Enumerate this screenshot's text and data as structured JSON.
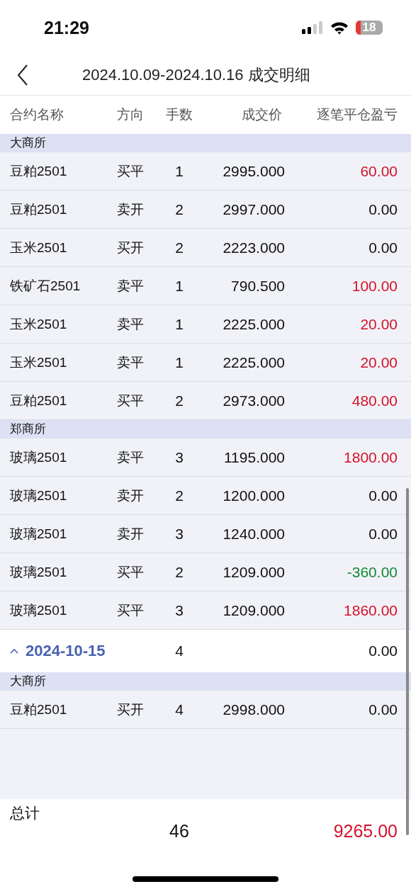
{
  "status_bar": {
    "time": "21:29",
    "battery": "18"
  },
  "nav": {
    "title": "2024.10.09-2024.10.16 成交明细"
  },
  "columns": [
    "合约名称",
    "方向",
    "手数",
    "成交价",
    "逐笔平仓盈亏"
  ],
  "items": [
    {
      "kind": "section",
      "label": "大商所"
    },
    {
      "kind": "trade",
      "name": "豆粕2501",
      "side": "买平",
      "qty": "1",
      "price": "2995.000",
      "pnl": "60.00",
      "color": "#d4122a"
    },
    {
      "kind": "trade",
      "name": "豆粕2501",
      "side": "卖开",
      "qty": "2",
      "price": "2997.000",
      "pnl": "0.00",
      "color": "#111111"
    },
    {
      "kind": "trade",
      "name": "玉米2501",
      "side": "买开",
      "qty": "2",
      "price": "2223.000",
      "pnl": "0.00",
      "color": "#111111"
    },
    {
      "kind": "trade",
      "name": "铁矿石2501",
      "side": "卖平",
      "qty": "1",
      "price": "790.500",
      "pnl": "100.00",
      "color": "#d4122a"
    },
    {
      "kind": "trade",
      "name": "玉米2501",
      "side": "卖平",
      "qty": "1",
      "price": "2225.000",
      "pnl": "20.00",
      "color": "#d4122a"
    },
    {
      "kind": "trade",
      "name": "玉米2501",
      "side": "卖平",
      "qty": "1",
      "price": "2225.000",
      "pnl": "20.00",
      "color": "#d4122a"
    },
    {
      "kind": "trade",
      "name": "豆粕2501",
      "side": "买平",
      "qty": "2",
      "price": "2973.000",
      "pnl": "480.00",
      "color": "#d4122a"
    },
    {
      "kind": "section",
      "label": "郑商所"
    },
    {
      "kind": "trade",
      "name": "玻璃2501",
      "side": "卖平",
      "qty": "3",
      "price": "1195.000",
      "pnl": "1800.00",
      "color": "#d4122a"
    },
    {
      "kind": "trade",
      "name": "玻璃2501",
      "side": "卖开",
      "qty": "2",
      "price": "1200.000",
      "pnl": "0.00",
      "color": "#111111"
    },
    {
      "kind": "trade",
      "name": "玻璃2501",
      "side": "卖开",
      "qty": "3",
      "price": "1240.000",
      "pnl": "0.00",
      "color": "#111111"
    },
    {
      "kind": "trade",
      "name": "玻璃2501",
      "side": "买平",
      "qty": "2",
      "price": "1209.000",
      "pnl": "-360.00",
      "color": "#138a35"
    },
    {
      "kind": "trade",
      "name": "玻璃2501",
      "side": "买平",
      "qty": "3",
      "price": "1209.000",
      "pnl": "1860.00",
      "color": "#d4122a"
    },
    {
      "kind": "date_group",
      "date": "2024-10-15",
      "expanded": true,
      "qty": "4",
      "pnl": "0.00",
      "color": "#111111"
    },
    {
      "kind": "section",
      "label": "大商所"
    },
    {
      "kind": "trade",
      "name": "豆粕2501",
      "side": "买开",
      "qty": "4",
      "price": "2998.000",
      "pnl": "0.00",
      "color": "#111111"
    }
  ],
  "total": {
    "label": "总计",
    "qty": "46",
    "pnl": "9265.00",
    "color": "#d4122a"
  }
}
